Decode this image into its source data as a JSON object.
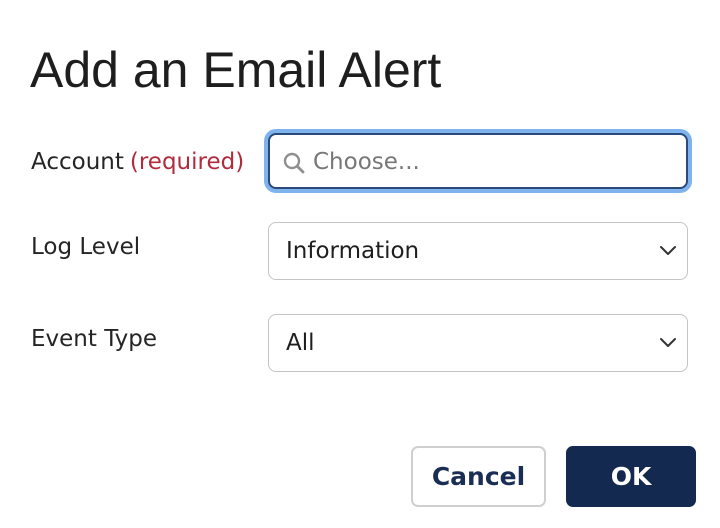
{
  "dialog": {
    "title": "Add an Email Alert"
  },
  "form": {
    "account": {
      "label": "Account",
      "required_text": "(required)",
      "placeholder": "Choose...",
      "value": ""
    },
    "log_level": {
      "label": "Log Level",
      "selected": "Information"
    },
    "event_type": {
      "label": "Event Type",
      "selected": "All"
    }
  },
  "buttons": {
    "cancel": "Cancel",
    "ok": "OK"
  },
  "colors": {
    "required": "#b12b3c",
    "focus_ring": "#7fb3ee",
    "primary_button": "#13294f"
  },
  "icons": {
    "account_search": "search-icon",
    "dropdown": "chevron-down-icon"
  }
}
